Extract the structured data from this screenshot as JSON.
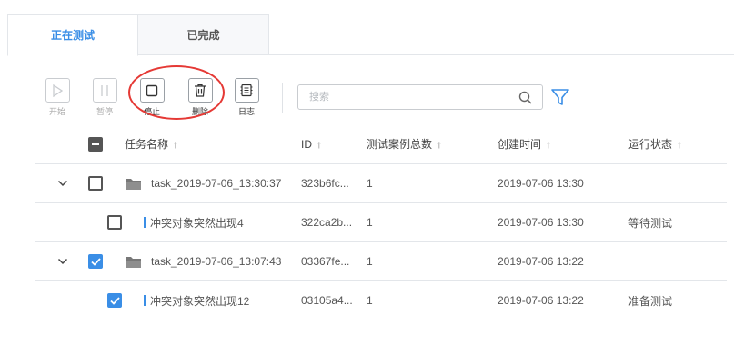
{
  "tabs": [
    {
      "label": "正在测试",
      "active": true
    },
    {
      "label": "已完成",
      "active": false
    }
  ],
  "toolbar": {
    "start": "开始",
    "pause": "暂停",
    "stop": "停止",
    "delete": "删除",
    "log": "日志"
  },
  "search": {
    "placeholder": "搜索",
    "value": ""
  },
  "table": {
    "columns": [
      "任务名称",
      "ID",
      "测试案例总数",
      "创建时间",
      "运行状态"
    ],
    "sort_arrow": "↑",
    "rows": [
      {
        "type": "task",
        "expanded": true,
        "checked": false,
        "name": "task_2019-07-06_13:30:37",
        "id": "323b6fc...",
        "count": "1",
        "created": "2019-07-06 13:30",
        "status": ""
      },
      {
        "type": "case",
        "checked": false,
        "name": "冲突对象突然出现4",
        "id": "322ca2b...",
        "count": "1",
        "created": "2019-07-06 13:30",
        "status": "等待测试"
      },
      {
        "type": "task",
        "expanded": true,
        "checked": true,
        "name": "task_2019-07-06_13:07:43",
        "id": "03367fe...",
        "count": "1",
        "created": "2019-07-06 13:22",
        "status": ""
      },
      {
        "type": "case",
        "checked": true,
        "name": "冲突对象突然出现12",
        "id": "03105a4...",
        "count": "1",
        "created": "2019-07-06 13:22",
        "status": "准备测试"
      }
    ]
  },
  "colors": {
    "accent": "#3a8ee6",
    "annotation": "#e53935",
    "border": "#e3e6ea"
  },
  "icons": [
    "play-icon",
    "pause-icon",
    "stop-icon",
    "trash-icon",
    "log-icon",
    "search-icon",
    "filter-icon",
    "chevron-down-icon",
    "folder-icon",
    "check-icon"
  ]
}
